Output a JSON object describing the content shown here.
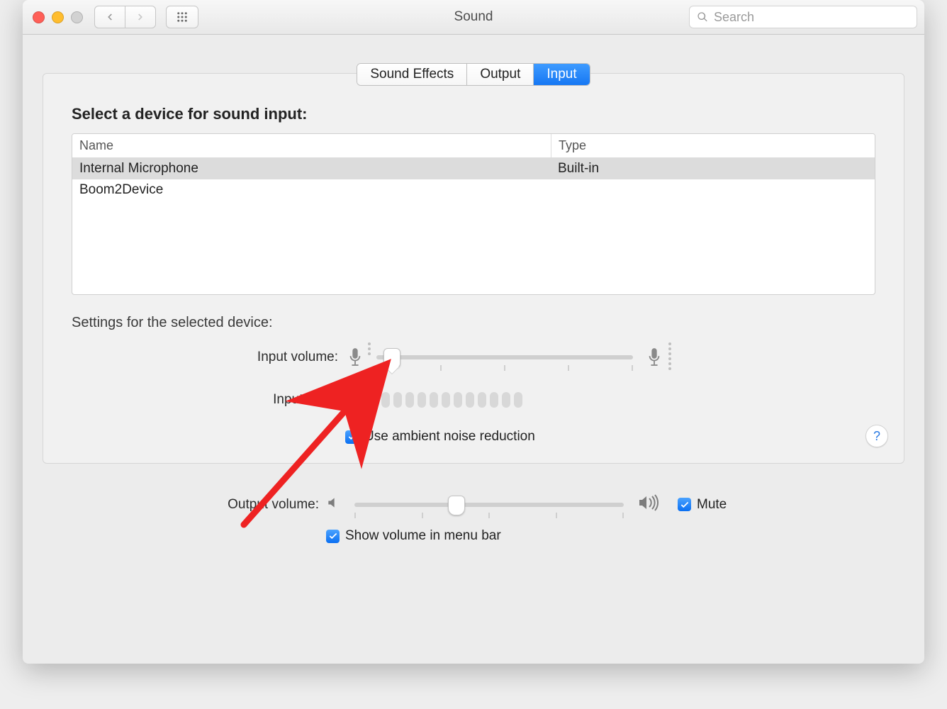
{
  "window": {
    "title": "Sound"
  },
  "search": {
    "placeholder": "Search"
  },
  "tabs": {
    "sound_effects": "Sound Effects",
    "output": "Output",
    "input": "Input"
  },
  "section": {
    "select_device": "Select a device for sound input:",
    "settings_for": "Settings for the selected device:"
  },
  "table": {
    "headers": {
      "name": "Name",
      "type": "Type"
    },
    "rows": [
      {
        "name": "Internal Microphone",
        "type": "Built-in",
        "selected": true
      },
      {
        "name": "Boom2Device",
        "type": "",
        "selected": false
      }
    ]
  },
  "labels": {
    "input_volume": "Input volume:",
    "input_level": "Input level:",
    "ambient": "Use ambient noise reduction",
    "output_volume": "Output volume:",
    "mute": "Mute",
    "show_volume": "Show volume in menu bar"
  },
  "sliders": {
    "input_percent": 6,
    "output_percent": 38
  },
  "checks": {
    "ambient": true,
    "mute": true,
    "show_volume": true
  },
  "help": "?"
}
